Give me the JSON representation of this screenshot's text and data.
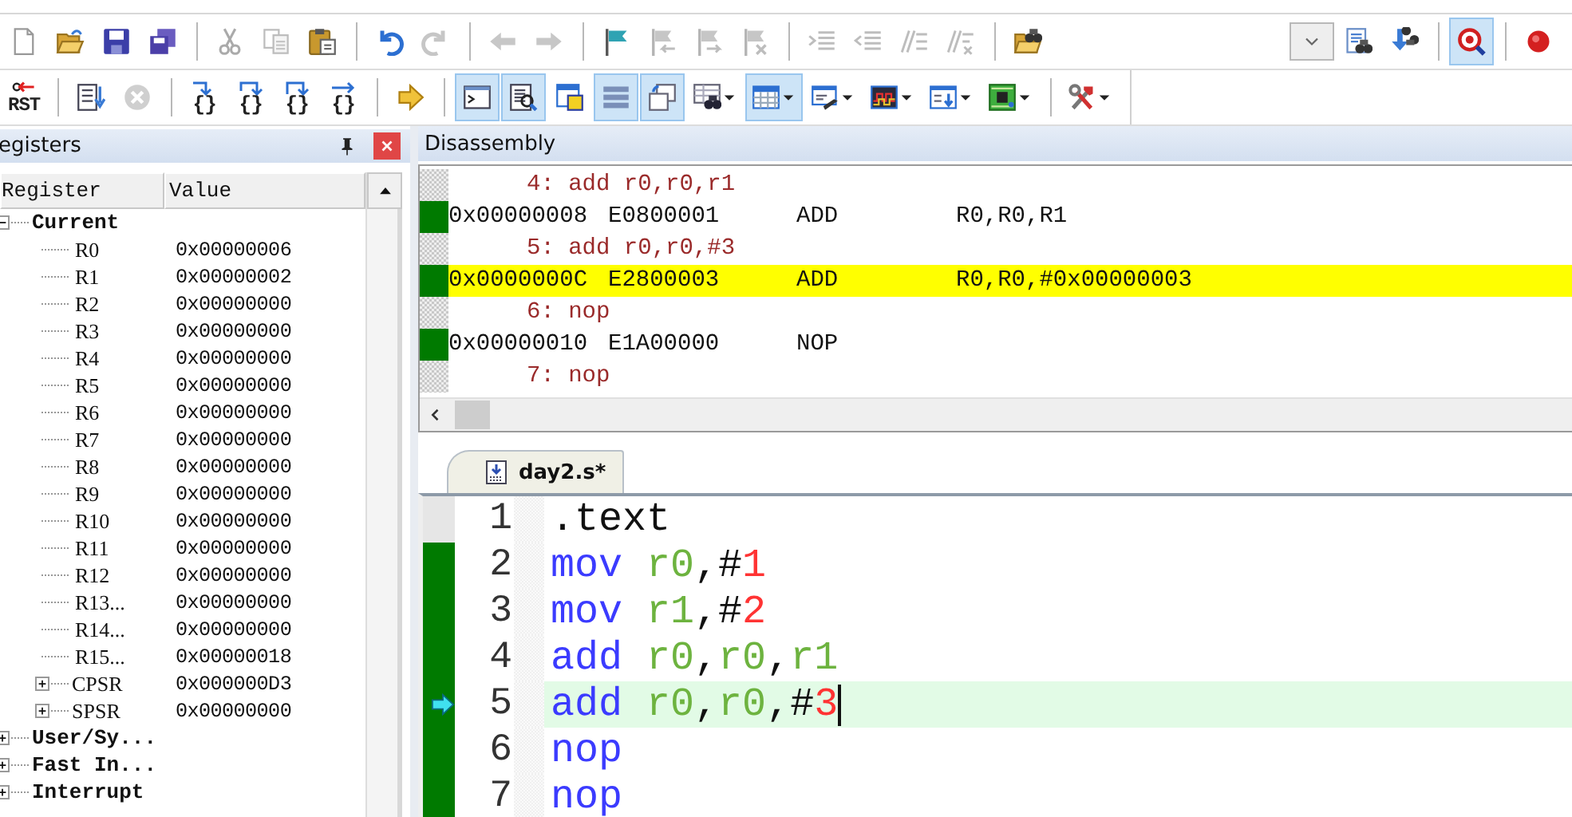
{
  "toolbar_1": {
    "left": [
      {
        "kind": "new-file",
        "disabled": false,
        "on": false
      },
      {
        "kind": "open",
        "disabled": false,
        "on": false
      },
      {
        "kind": "save",
        "disabled": false,
        "on": false
      },
      {
        "kind": "save-all",
        "disabled": false,
        "on": false
      },
      {
        "kind": "separator"
      },
      {
        "kind": "cut",
        "disabled": true,
        "on": false
      },
      {
        "kind": "copy",
        "disabled": true,
        "on": false
      },
      {
        "kind": "paste",
        "disabled": false,
        "on": false
      },
      {
        "kind": "separator"
      },
      {
        "kind": "undo",
        "disabled": false,
        "on": false
      },
      {
        "kind": "redo",
        "disabled": true,
        "on": false
      },
      {
        "kind": "separator"
      },
      {
        "kind": "back",
        "disabled": true,
        "on": false
      },
      {
        "kind": "forward",
        "disabled": true,
        "on": false
      },
      {
        "kind": "separator"
      },
      {
        "kind": "bookmark",
        "disabled": false,
        "on": false
      },
      {
        "kind": "prev-bookmark",
        "disabled": true,
        "on": false
      },
      {
        "kind": "next-bookmark",
        "disabled": true,
        "on": false
      },
      {
        "kind": "clear-bookmarks",
        "disabled": true,
        "on": false
      },
      {
        "kind": "separator"
      },
      {
        "kind": "indent",
        "disabled": true,
        "on": false
      },
      {
        "kind": "unindent",
        "disabled": true,
        "on": false
      },
      {
        "kind": "comment",
        "disabled": true,
        "on": false
      },
      {
        "kind": "uncomment",
        "disabled": true,
        "on": false
      },
      {
        "kind": "separator"
      },
      {
        "kind": "find-in-files",
        "disabled": false,
        "on": false
      }
    ],
    "right": [
      {
        "kind": "combo",
        "disabled": false,
        "on": false
      },
      {
        "kind": "find",
        "disabled": false,
        "on": false
      },
      {
        "kind": "incremental-find",
        "disabled": false,
        "on": false
      },
      {
        "kind": "separator"
      },
      {
        "kind": "debug",
        "disabled": false,
        "on": true
      },
      {
        "kind": "separator"
      },
      {
        "kind": "breakpoint",
        "disabled": false,
        "on": false
      }
    ]
  },
  "toolbar_2": [
    {
      "kind": "reset",
      "label": "RST",
      "disabled": false,
      "on": false,
      "menu": false
    },
    {
      "kind": "separator"
    },
    {
      "kind": "run",
      "disabled": false,
      "on": false,
      "menu": false
    },
    {
      "kind": "stop",
      "disabled": true,
      "on": false,
      "menu": false
    },
    {
      "kind": "separator"
    },
    {
      "kind": "step-into",
      "label": "{}",
      "disabled": false,
      "on": false,
      "menu": false
    },
    {
      "kind": "step-over",
      "label": "{}",
      "disabled": false,
      "on": false,
      "menu": false
    },
    {
      "kind": "step-out",
      "label": "{}",
      "disabled": false,
      "on": false,
      "menu": false
    },
    {
      "kind": "run-to-cursor",
      "label": "{}",
      "disabled": false,
      "on": false,
      "menu": false
    },
    {
      "kind": "separator"
    },
    {
      "kind": "show-next",
      "disabled": false,
      "on": false,
      "menu": false
    },
    {
      "kind": "separator"
    },
    {
      "kind": "command-window",
      "disabled": false,
      "on": true,
      "menu": false
    },
    {
      "kind": "disassembly-window",
      "disabled": false,
      "on": true,
      "menu": false
    },
    {
      "kind": "symbols-window",
      "disabled": false,
      "on": false,
      "menu": false
    },
    {
      "kind": "registers-window",
      "disabled": false,
      "on": true,
      "menu": false
    },
    {
      "kind": "call-stack-window",
      "disabled": false,
      "on": true,
      "menu": false
    },
    {
      "kind": "watch-window",
      "disabled": false,
      "on": false,
      "menu": true
    },
    {
      "kind": "memory-window",
      "disabled": false,
      "on": true,
      "menu": true
    },
    {
      "kind": "serial-window",
      "disabled": false,
      "on": false,
      "menu": true
    },
    {
      "kind": "logic-analyzer",
      "disabled": false,
      "on": false,
      "menu": true
    },
    {
      "kind": "trace-window",
      "disabled": false,
      "on": false,
      "menu": true
    },
    {
      "kind": "system-viewer",
      "disabled": false,
      "on": false,
      "menu": true
    },
    {
      "kind": "separator"
    },
    {
      "kind": "tools",
      "disabled": false,
      "on": false,
      "menu": true
    }
  ],
  "registers": {
    "title": "egisters",
    "columns": [
      "Register",
      "Value"
    ],
    "items": [
      {
        "name": "Current",
        "expanded": true,
        "children": [
          {
            "name": "R0",
            "value": "0x00000006"
          },
          {
            "name": "R1",
            "value": "0x00000002"
          },
          {
            "name": "R2",
            "value": "0x00000000"
          },
          {
            "name": "R3",
            "value": "0x00000000"
          },
          {
            "name": "R4",
            "value": "0x00000000"
          },
          {
            "name": "R5",
            "value": "0x00000000"
          },
          {
            "name": "R6",
            "value": "0x00000000"
          },
          {
            "name": "R7",
            "value": "0x00000000"
          },
          {
            "name": "R8",
            "value": "0x00000000"
          },
          {
            "name": "R9",
            "value": "0x00000000"
          },
          {
            "name": "R10",
            "value": "0x00000000"
          },
          {
            "name": "R11",
            "value": "0x00000000"
          },
          {
            "name": "R12",
            "value": "0x00000000"
          },
          {
            "name": "R13...",
            "value": "0x00000000"
          },
          {
            "name": "R14...",
            "value": "0x00000000"
          },
          {
            "name": "R15...",
            "value": "0x00000018"
          },
          {
            "name": "CPSR",
            "value": "0x000000D3",
            "expanded": false
          },
          {
            "name": "SPSR",
            "value": "0x00000000",
            "expanded": false
          }
        ]
      },
      {
        "name": "User/Sy...",
        "expanded": false
      },
      {
        "name": "Fast In...",
        "expanded": false
      },
      {
        "name": "Interrupt",
        "expanded": false
      }
    ]
  },
  "disassembly": {
    "title": "Disassembly",
    "lines": [
      {
        "kind": "source",
        "text": "4: add r0,r0,r1",
        "selected": false
      },
      {
        "kind": "asm",
        "address": "0x00000008",
        "opcode": "E0800001",
        "mnemonic": "ADD",
        "operands": "R0,R0,R1",
        "selected": false
      },
      {
        "kind": "source",
        "text": "5: add r0,r0,#3",
        "selected": false
      },
      {
        "kind": "asm",
        "address": "0x0000000C",
        "opcode": "E2800003",
        "mnemonic": "ADD",
        "operands": "R0,R0,#0x00000003",
        "selected": true
      },
      {
        "kind": "source",
        "text": "6: nop",
        "selected": false
      },
      {
        "kind": "asm",
        "address": "0x00000010",
        "opcode": "E1A00000",
        "mnemonic": "NOP",
        "selected": false
      },
      {
        "kind": "source",
        "text": "7: nop",
        "selected": false
      }
    ]
  },
  "editor": {
    "tabs": [
      {
        "label": "day2.s*",
        "selected": true
      }
    ],
    "lines": [
      {
        "number": "1",
        "executed": false,
        "current": false,
        "cursor": false,
        "tokens": [
          {
            "kind": "plain",
            "text": ".text"
          }
        ]
      },
      {
        "number": "2",
        "executed": true,
        "current": false,
        "cursor": false,
        "tokens": [
          {
            "kind": "keyword",
            "text": "mov "
          },
          {
            "kind": "register",
            "text": "r0"
          },
          {
            "kind": "plain",
            "text": ",#"
          },
          {
            "kind": "number",
            "text": "1"
          }
        ]
      },
      {
        "number": "3",
        "executed": true,
        "current": false,
        "cursor": false,
        "tokens": [
          {
            "kind": "keyword",
            "text": "mov "
          },
          {
            "kind": "register",
            "text": "r1"
          },
          {
            "kind": "plain",
            "text": ",#"
          },
          {
            "kind": "number",
            "text": "2"
          }
        ]
      },
      {
        "number": "4",
        "executed": true,
        "current": false,
        "cursor": false,
        "tokens": [
          {
            "kind": "keyword",
            "text": "add "
          },
          {
            "kind": "register",
            "text": "r0"
          },
          {
            "kind": "plain",
            "text": ","
          },
          {
            "kind": "register",
            "text": "r0"
          },
          {
            "kind": "plain",
            "text": ","
          },
          {
            "kind": "register",
            "text": "r1"
          }
        ]
      },
      {
        "number": "5",
        "executed": true,
        "current": true,
        "cursor": true,
        "tokens": [
          {
            "kind": "keyword",
            "text": "add "
          },
          {
            "kind": "register",
            "text": "r0"
          },
          {
            "kind": "plain",
            "text": ","
          },
          {
            "kind": "register",
            "text": "r0"
          },
          {
            "kind": "plain",
            "text": ",#"
          },
          {
            "kind": "number",
            "text": "3"
          }
        ]
      },
      {
        "number": "6",
        "executed": true,
        "current": false,
        "cursor": false,
        "tokens": [
          {
            "kind": "keyword",
            "text": "nop"
          }
        ]
      },
      {
        "number": "7",
        "executed": true,
        "current": false,
        "cursor": false,
        "tokens": [
          {
            "kind": "keyword",
            "text": "nop"
          }
        ]
      }
    ]
  }
}
